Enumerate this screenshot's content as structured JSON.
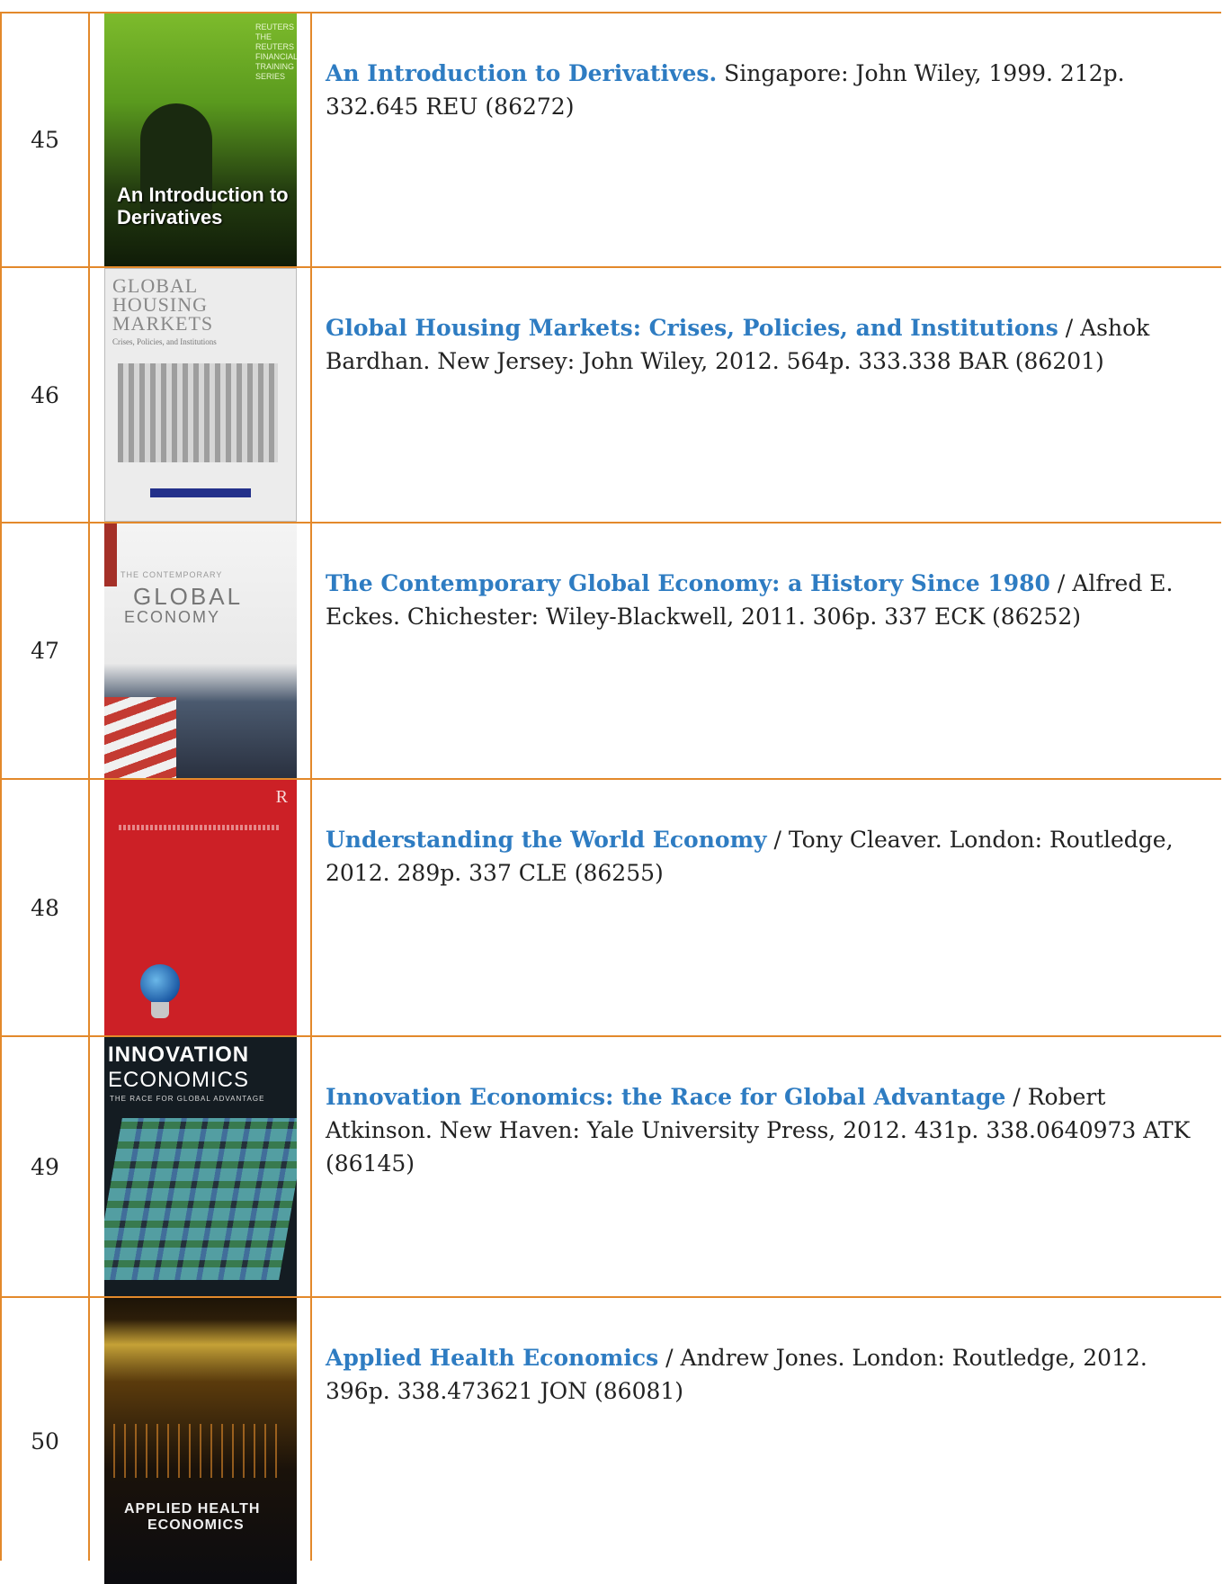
{
  "rows": [
    {
      "number": "45",
      "title": "An Introduction to Derivatives.",
      "details": " Singapore: John Wiley, 1999. 212p. 332.645 REU (86272)",
      "cover": {
        "icon": "book-cover",
        "caption": "An Introduction to Derivatives",
        "brand": "REUTERS THE REUTERS FINANCIAL TRAINING SERIES"
      }
    },
    {
      "number": "46",
      "title": "Global Housing Markets: Crises, Policies, and Institutions",
      "details": " / Ashok Bardhan. New Jersey: John Wiley, 2012. 564p. 333.338 BAR (86201)",
      "cover": {
        "icon": "book-cover",
        "caption": "GLOBAL HOUSING MARKETS",
        "subtitle": "Crises, Policies, and Institutions"
      }
    },
    {
      "number": "47",
      "title": "The Contemporary Global Economy: a History Since 1980",
      "details": " / Alfred E. Eckes. Chichester: Wiley-Blackwell, 2011. 306p. 337 ECK (86252)",
      "cover": {
        "icon": "book-cover",
        "caption_top": "THE CONTEMPORARY",
        "caption_mid": "GLOBAL",
        "caption_bottom": "ECONOMY"
      }
    },
    {
      "number": "48",
      "title": "Understanding the World Economy",
      "details": " / Tony Cleaver. London: Routledge, 2012. 289p. 337 CLE (86255)",
      "cover": {
        "icon": "book-cover",
        "publisher_mark": "R"
      }
    },
    {
      "number": "49",
      "title": "Innovation Economics: the Race for Global Advantage",
      "details": " / Robert Atkinson. New Haven: Yale University Press, 2012. 431p. 338.0640973 ATK (86145)",
      "cover": {
        "icon": "book-cover",
        "caption_top": "INNOVATION",
        "caption_mid": "ECONOMICS",
        "caption_bottom": "THE RACE FOR GLOBAL ADVANTAGE"
      }
    },
    {
      "number": "50",
      "title": "Applied Health Economics",
      "details": " / Andrew Jones. London: Routledge, 2012. 396p. 338.473621 JON (86081)",
      "cover": {
        "icon": "book-cover",
        "caption_top": "APPLIED HEALTH",
        "caption_bottom": "ECONOMICS"
      }
    }
  ],
  "colors": {
    "border": "#E3892B",
    "title_link": "#2E7CC2",
    "text": "#222222"
  }
}
